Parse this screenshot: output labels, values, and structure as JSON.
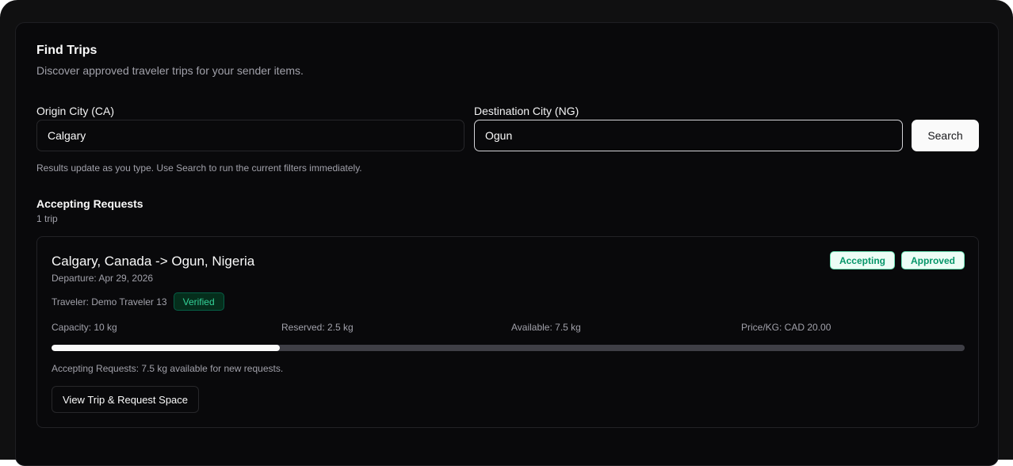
{
  "header": {
    "title": "Find Trips",
    "subtitle": "Discover approved traveler trips for your sender items."
  },
  "filters": {
    "origin_label": "Origin City (CA)",
    "origin_value": "Calgary",
    "destination_label": "Destination City (NG)",
    "destination_value": "Ogun",
    "search_label": "Search",
    "hint": "Results update as you type. Use Search to run the current filters immediately."
  },
  "results": {
    "section_title": "Accepting Requests",
    "count": "1 trip",
    "trips": [
      {
        "route": "Calgary, Canada -> Ogun, Nigeria",
        "departure": "Departure: Apr 29, 2026",
        "badges": [
          "Accepting",
          "Approved"
        ],
        "traveler": "Traveler: Demo Traveler 13",
        "traveler_status": "Verified",
        "capacity": "Capacity: 10 kg",
        "reserved": "Reserved: 2.5 kg",
        "available": "Available: 7.5 kg",
        "price": "Price/KG: CAD 20.00",
        "reserved_fraction": 0.25,
        "note": "Accepting Requests: 7.5 kg available for new requests.",
        "action_label": "View Trip & Request Space"
      }
    ]
  },
  "colors": {
    "background": "#09090b",
    "badge_green": "#059669",
    "verified_green": "#34d399"
  }
}
